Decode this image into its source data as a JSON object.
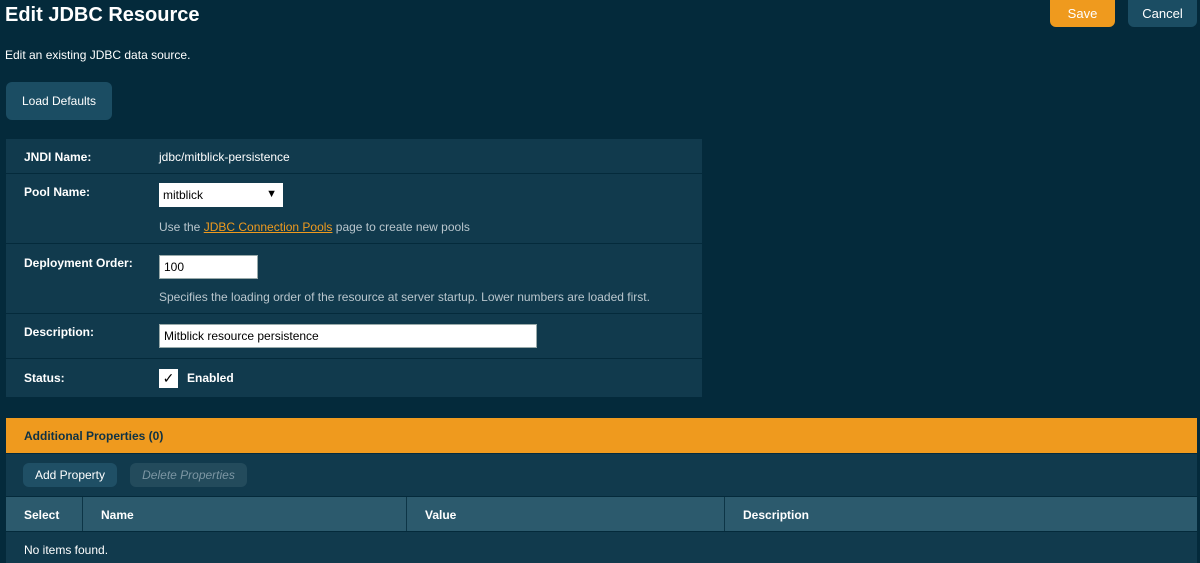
{
  "header": {
    "title": "Edit JDBC Resource",
    "subtitle": "Edit an existing JDBC data source.",
    "save_label": "Save",
    "cancel_label": "Cancel",
    "load_defaults_label": "Load Defaults"
  },
  "form": {
    "jndi": {
      "label": "JNDI Name:",
      "value": "jdbc/mitblick-persistence"
    },
    "pool": {
      "label": "Pool Name:",
      "selected": "mitblick",
      "help_prefix": "Use the ",
      "help_link": "JDBC Connection Pools",
      "help_suffix": " page to create new pools"
    },
    "deployment": {
      "label": "Deployment Order:",
      "value": "100",
      "help": "Specifies the loading order of the resource at server startup. Lower numbers are loaded first."
    },
    "description": {
      "label": "Description:",
      "value": "Mitblick resource persistence"
    },
    "status": {
      "label": "Status:",
      "checked_glyph": "✓",
      "checkbox_label": "Enabled"
    }
  },
  "properties": {
    "header": "Additional Properties (0)",
    "add_label": "Add Property",
    "delete_label": "Delete Properties",
    "columns": [
      "Select",
      "Name",
      "Value",
      "Description"
    ],
    "empty_text": "No items found."
  },
  "colors": {
    "background": "#042a3b",
    "panel": "#113a4d",
    "accent": "#ef9a1e",
    "table_header": "#2c5a6d"
  },
  "icons": {
    "dropdown": "triangle-down-icon",
    "checkbox": "checkmark-icon"
  }
}
